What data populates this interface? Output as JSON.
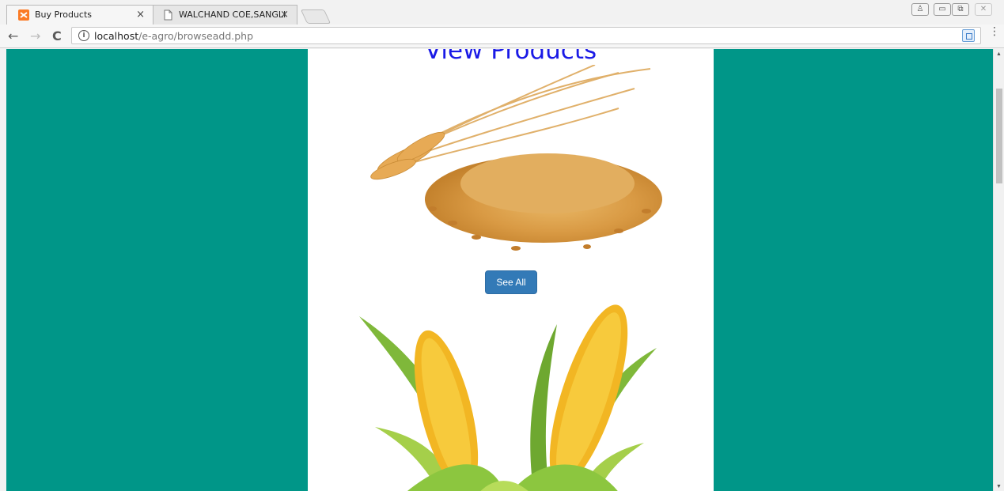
{
  "browser": {
    "tabs": [
      {
        "title": "Buy Products",
        "close": "×",
        "icon": "xampp-icon"
      },
      {
        "title": "WALCHAND COE,SANGLI",
        "close": "×",
        "icon": "page-icon"
      }
    ],
    "url_host": "localhost",
    "url_path": "/e-agro/browseadd.php",
    "nav": {
      "back": "←",
      "forward": "→",
      "reload": "C"
    },
    "star": "☆",
    "menu": "⋮",
    "window_controls": [
      "♙",
      "▭",
      "⧉",
      "✕"
    ]
  },
  "page": {
    "heading": "View Products",
    "see_all_label": "See All",
    "products": [
      {
        "name": "wheat",
        "icon": "wheat-image"
      },
      {
        "name": "corn",
        "icon": "corn-image"
      }
    ]
  },
  "colors": {
    "page_bg": "#009688",
    "heading": "#1a1ae6",
    "button": "#337ab7"
  }
}
